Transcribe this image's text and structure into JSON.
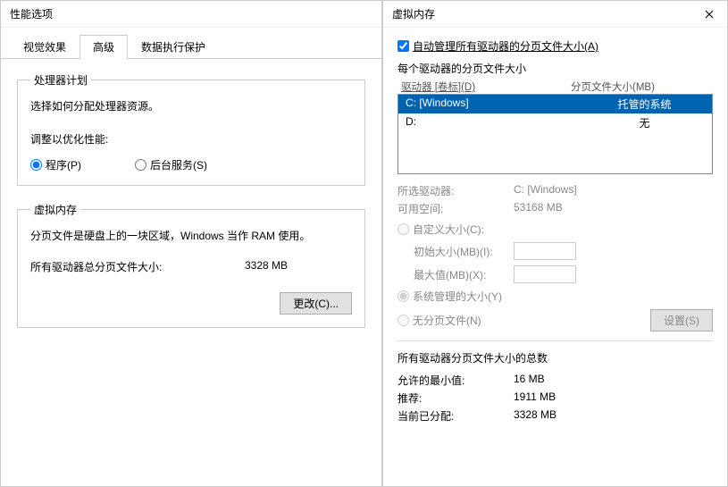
{
  "left": {
    "title": "性能选项",
    "tabs": [
      "视觉效果",
      "高级",
      "数据执行保护"
    ],
    "active_tab": 1,
    "cpu_group": {
      "legend": "处理器计划",
      "desc": "选择如何分配处理器资源。",
      "adjust_label": "调整以优化性能:",
      "opt_program": "程序(P)",
      "opt_bgservice": "后台服务(S)"
    },
    "vm_group": {
      "legend": "虚拟内存",
      "desc": "分页文件是硬盘上的一块区域，Windows 当作 RAM 使用。",
      "total_label": "所有驱动器总分页文件大小:",
      "total_value": "3328 MB",
      "change_btn": "更改(C)..."
    }
  },
  "right": {
    "title": "虚拟内存",
    "auto_manage": "自动管理所有驱动器的分页文件大小(A)",
    "auto_manage_checked": true,
    "each_drive_label": "每个驱动器的分页文件大小",
    "col_drive": "驱动器 [卷标](D)",
    "col_size": "分页文件大小(MB)",
    "drives": [
      {
        "label": "C:   [Windows]",
        "size": "托管的系统",
        "selected": true
      },
      {
        "label": "D:",
        "size": "无",
        "selected": false
      }
    ],
    "selected_drive_label": "所选驱动器:",
    "selected_drive_value": "C:  [Windows]",
    "avail_label": "可用空间:",
    "avail_value": "53168 MB",
    "custom_label": "自定义大小(C):",
    "initial_label": "初始大小(MB)(I):",
    "max_label": "最大值(MB)(X):",
    "sys_managed_label": "系统管理的大小(Y)",
    "no_paging_label": "无分页文件(N)",
    "set_btn": "设置(S)",
    "totals_title": "所有驱动器分页文件大小的总数",
    "min_label": "允许的最小值:",
    "min_value": "16 MB",
    "rec_label": "推荐:",
    "rec_value": "1911 MB",
    "cur_label": "当前已分配:",
    "cur_value": "3328 MB"
  }
}
